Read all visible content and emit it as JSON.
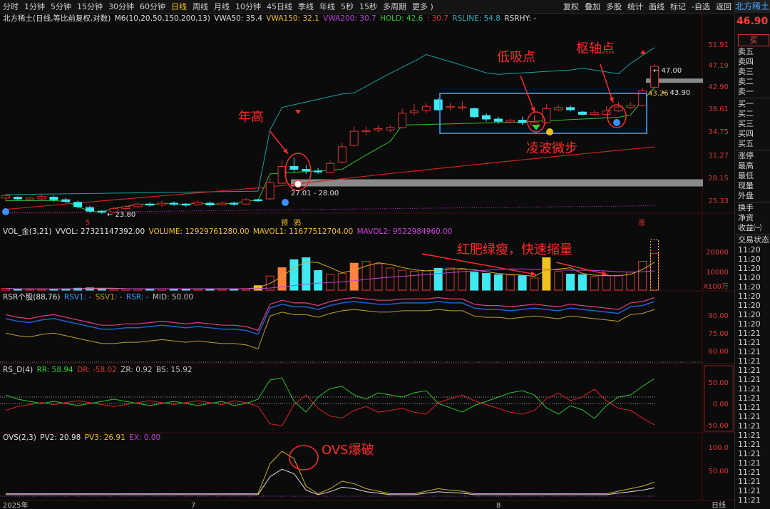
{
  "toolbar": {
    "periods": [
      "分时",
      "1分钟",
      "5分钟",
      "15分钟",
      "30分钟",
      "60分钟",
      "日线",
      "周线",
      "月线",
      "10分钟",
      "45日线",
      "季线",
      "年线",
      "5秒",
      "15秒",
      "多周期",
      "更多 )"
    ],
    "active_period": "日线",
    "right": [
      "复权",
      "叠加",
      "多股",
      "统计",
      "画线",
      "标记",
      "-自选",
      "返回"
    ]
  },
  "stock_tab": "北方稀土",
  "price_legend": {
    "title": "北方稀土(日线,等比前复权,对数)",
    "ma": "M6(10,20,50,150,200,13)",
    "vwa50": "VWA50: 35.4",
    "vwa150": "VWA150: 32.1",
    "vwa200": "VWA200: 30.7",
    "hold": "HOLD: 42.6",
    "hold2": ": 30.7",
    "rsline": "RSLINE: 54.8",
    "rsrhy": "RSRHY: -"
  },
  "price_axis": [
    "51.91",
    "47.19",
    "42.90",
    "38.61",
    "34.75",
    "31.27",
    "28.15",
    "25.33"
  ],
  "price_annotations": {
    "high_label": "47.00",
    "mid_label": "43.90",
    "mid_label2": "43.26",
    "box_low": "27.01 - 28.00",
    "low_label": "23.80",
    "nian_gao": "年高",
    "di_xi_dian": "低吸点",
    "shu_zhou_dian": "枢轴点",
    "ling_bo": "凌波微步",
    "marker_yu": "预",
    "marker_ya": "鸦",
    "marker_zhang": "涨",
    "marker_5": "5"
  },
  "vol_legend": {
    "title": "VOL_金(3,21)",
    "vvol": "VVOL: 27321147392.00",
    "volume": "VOLUME: 12929761280.00",
    "mavol1": "MAVOL1: 11677512704.00",
    "mavol2": "MAVOL2: 9522984960.00"
  },
  "vol_axis": [
    "20000",
    "10000",
    "X100万"
  ],
  "vol_annotation": "红肥绿瘦，快速缩量",
  "rsr_legend": {
    "title": "RSR个股(88,76)",
    "rsv1": "RSV1: -",
    "ssv1": "SSV1: -",
    "rsr": "RSR: -",
    "mid": "MID: 50.00"
  },
  "rsr_axis": [
    "90.00",
    "75.00",
    "60.00"
  ],
  "rsd_legend": {
    "title": "RS_D(4)",
    "rr": "RR: 58.94",
    "dr": "DR: -58.02",
    "zr": "ZR: 0.92",
    "bs": "BS: 15.92"
  },
  "rsd_axis": [
    "50.00",
    "0.00",
    "-50.00"
  ],
  "ovs_legend": {
    "title": "OVS(2,3)",
    "pv2": "PV2: 20.98",
    "pv3": "PV3: 26.91",
    "ex": "EX: 0.00"
  },
  "ovs_axis": [
    "100.0",
    "50.00"
  ],
  "ovs_annotation": "OVS爆破",
  "time_axis": [
    "2025年",
    "7",
    "8"
  ],
  "period_footer": "日线",
  "sidebar": {
    "price": "46.90",
    "price_extra": "4",
    "buy": "买",
    "sell_rows": [
      "卖五",
      "卖四",
      "卖三",
      "卖二",
      "卖一"
    ],
    "buy_rows": [
      "买一",
      "买二",
      "买三",
      "买四",
      "买五"
    ],
    "info_rows": [
      "涨停",
      "最高",
      "最低",
      "现量",
      "外盘"
    ],
    "info_rows2": [
      "换手",
      "净资",
      "收益㈠"
    ],
    "ticks_title": "交易状态:",
    "ticks": [
      "11:20",
      "11:20",
      "11:20",
      "11:20",
      "11:20",
      "11:20",
      "11:20",
      "11:20",
      "11:20",
      "11:21",
      "11:21",
      "11:21",
      "11:21",
      "11:21",
      "11:21",
      "11:21",
      "11:21",
      "11:21",
      "11:21",
      "11:21",
      "11:21",
      "11:21",
      "11:21",
      "11:21",
      "11:21",
      "11:21",
      "11:21",
      "11:21",
      "11:21",
      "11:21",
      "11:21"
    ]
  },
  "colors": {
    "up": "#e03030",
    "down": "#40e8f0",
    "annot": "#ff2a2a",
    "box": "#3aa0ff",
    "yellow": "#f0c020",
    "orange": "#ff8040",
    "purple": "#c040e0"
  }
}
